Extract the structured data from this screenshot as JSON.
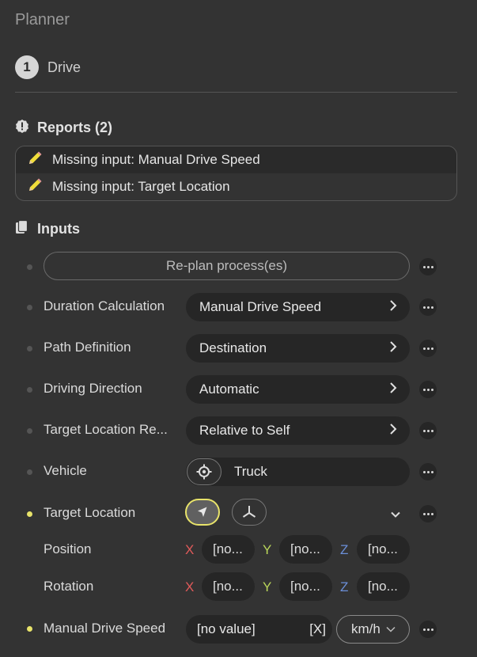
{
  "panel": {
    "title": "Planner"
  },
  "step": {
    "number": "1",
    "label": "Drive"
  },
  "reports": {
    "title": "Reports (2)",
    "items": [
      {
        "text": "Missing input: Manual Drive Speed"
      },
      {
        "text": "Missing input: Target Location"
      }
    ]
  },
  "inputs": {
    "title": "Inputs",
    "replan_label": "Re-plan process(es)",
    "duration": {
      "label": "Duration Calculation",
      "value": "Manual Drive Speed"
    },
    "path": {
      "label": "Path Definition",
      "value": "Destination"
    },
    "direction": {
      "label": "Driving Direction",
      "value": "Automatic"
    },
    "target_ref": {
      "label": "Target Location Re...",
      "value": "Relative to Self"
    },
    "vehicle": {
      "label": "Vehicle",
      "value": "Truck"
    },
    "target_location": {
      "label": "Target Location"
    },
    "position": {
      "label": "Position",
      "x": "[no...",
      "y": "[no...",
      "z": "[no..."
    },
    "rotation": {
      "label": "Rotation",
      "x": "[no...",
      "y": "[no...",
      "z": "[no..."
    },
    "speed": {
      "label": "Manual Drive Speed",
      "value": "[no value]",
      "clear": "[X]",
      "unit": "km/h"
    },
    "axes": {
      "x": "X",
      "y": "Y",
      "z": "Z"
    }
  },
  "colors": {
    "background": "#333333",
    "field": "#262626",
    "active_dot": "#e8e36a",
    "axis_x": "#e05a5a",
    "axis_y": "#b9d55a",
    "axis_z": "#6b8fd8"
  },
  "icons": {
    "report": "alert-badge-icon",
    "missing": "pencil-icon",
    "inputs": "documents-icon",
    "more": "more-dots-icon",
    "chevron": "chevron-right-icon",
    "picker": "crosshair-icon",
    "mode_select": "cursor-arrow-icon",
    "mode_axis": "tripod-axis-icon",
    "expand": "chevron-down-icon"
  }
}
